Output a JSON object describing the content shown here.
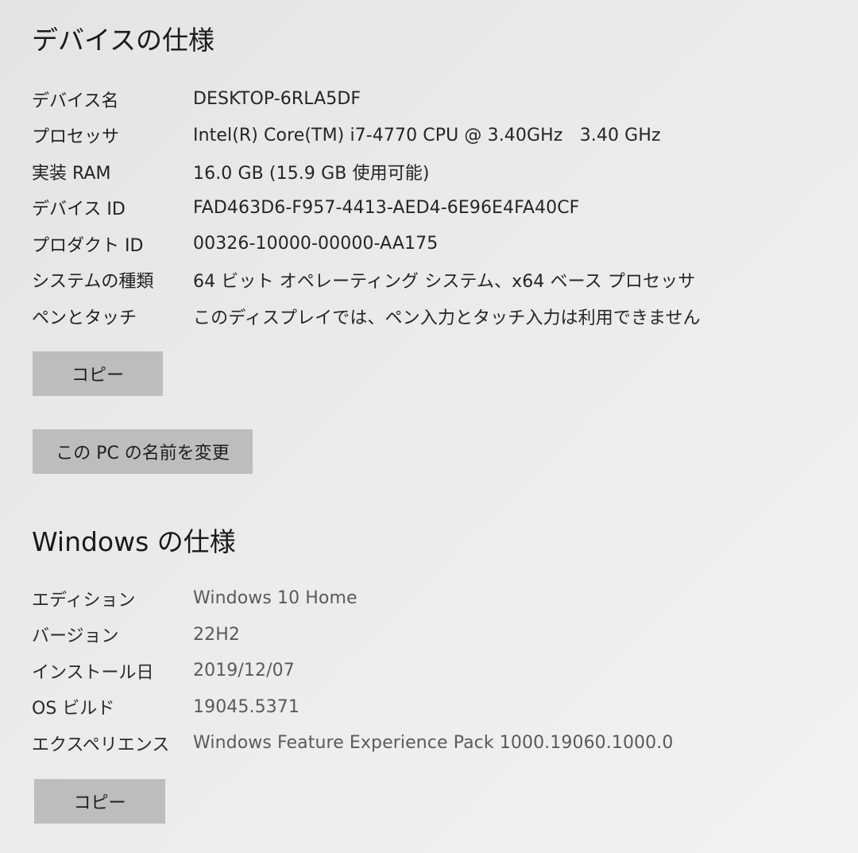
{
  "device_specs": {
    "title": "デバイスの仕様",
    "rows": [
      {
        "label": "デバイス名",
        "value": "DESKTOP-6RLA5DF"
      },
      {
        "label": "プロセッサ",
        "value": "Intel(R) Core(TM) i7-4770 CPU @ 3.40GHz   3.40 GHz"
      },
      {
        "label": "実装 RAM",
        "value": "16.0 GB (15.9 GB 使用可能)"
      },
      {
        "label": "デバイス ID",
        "value": "FAD463D6-F957-4413-AED4-6E96E4FA40CF"
      },
      {
        "label": "プロダクト ID",
        "value": "00326-10000-00000-AA175"
      },
      {
        "label": "システムの種類",
        "value": "64 ビット オペレーティング システム、x64 ベース プロセッサ"
      },
      {
        "label": "ペンとタッチ",
        "value": "このディスプレイでは、ペン入力とタッチ入力は利用できません"
      }
    ],
    "copy_button": "コピー",
    "rename_button": "この PC の名前を変更"
  },
  "windows_specs": {
    "title": "Windows の仕様",
    "rows": [
      {
        "label": "エディション",
        "value": "Windows 10 Home"
      },
      {
        "label": "バージョン",
        "value": "22H2"
      },
      {
        "label": "インストール日",
        "value": "2019/12/07"
      },
      {
        "label": "OS ビルド",
        "value": "19045.5371"
      },
      {
        "label": "エクスペリエンス",
        "value": "Windows Feature Experience Pack 1000.19060.1000.0"
      }
    ],
    "copy_button": "コピー"
  }
}
